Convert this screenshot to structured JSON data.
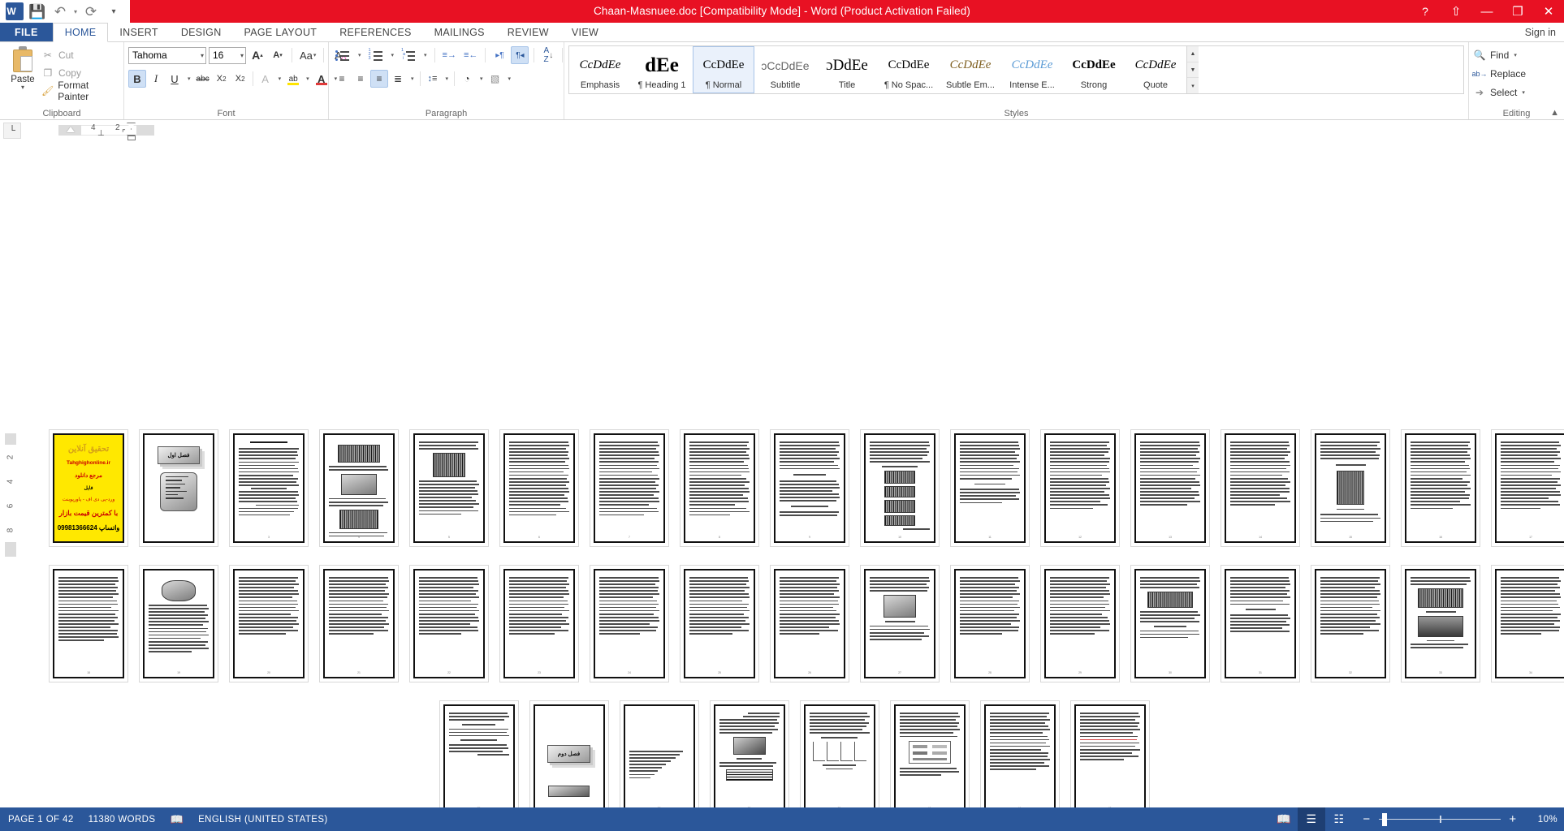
{
  "titlebar": {
    "title": "Chaan-Masnuee.doc [Compatibility Mode]  -  Word (Product Activation Failed)",
    "qat": [
      {
        "name": "word-logo-icon",
        "glyph": "W"
      },
      {
        "name": "save-icon",
        "glyph": "💾"
      },
      {
        "name": "undo-icon",
        "glyph": "↶"
      },
      {
        "name": "redo-icon",
        "glyph": "↻"
      },
      {
        "name": "customize-qat-icon",
        "glyph": "▾"
      }
    ],
    "window": [
      {
        "name": "help-icon",
        "glyph": "?"
      },
      {
        "name": "ribbon-display-options-icon",
        "glyph": "⬆"
      },
      {
        "name": "minimize-icon",
        "glyph": "—"
      },
      {
        "name": "restore-icon",
        "glyph": "❐"
      },
      {
        "name": "close-icon",
        "glyph": "✕"
      }
    ]
  },
  "tabs": {
    "file_label": "FILE",
    "items": [
      "HOME",
      "INSERT",
      "DESIGN",
      "PAGE LAYOUT",
      "REFERENCES",
      "MAILINGS",
      "REVIEW",
      "VIEW"
    ],
    "active": "HOME",
    "signin_label": "Sign in"
  },
  "ribbon": {
    "clipboard": {
      "group_label": "Clipboard",
      "paste_label": "Paste",
      "items": [
        {
          "label": "Cut",
          "icon": "scissors-icon",
          "glyph": "✂",
          "enabled": false
        },
        {
          "label": "Copy",
          "icon": "copy-icon",
          "glyph": "❐",
          "enabled": false
        },
        {
          "label": "Format Painter",
          "icon": "format-painter-icon",
          "glyph": "🖌",
          "enabled": true
        }
      ]
    },
    "font": {
      "group_label": "Font",
      "font_name": "Tahoma",
      "font_size": "16",
      "buttons": [
        {
          "name": "grow-font-button",
          "glyph": "A▴"
        },
        {
          "name": "shrink-font-button",
          "glyph": "A▾"
        },
        {
          "name": "change-case-button",
          "glyph": "Aa"
        },
        {
          "name": "clear-formatting-button",
          "glyph": "A"
        },
        {
          "name": "bold-button",
          "glyph": "B",
          "active": true
        },
        {
          "name": "italic-button",
          "glyph": "I"
        },
        {
          "name": "underline-button",
          "glyph": "U"
        },
        {
          "name": "strikethrough-button",
          "glyph": "abc"
        },
        {
          "name": "subscript-button",
          "glyph": "X₂"
        },
        {
          "name": "superscript-button",
          "glyph": "X²"
        },
        {
          "name": "text-effects-button",
          "glyph": "A"
        },
        {
          "name": "highlight-color-button",
          "glyph": "ab"
        },
        {
          "name": "font-color-button",
          "glyph": "A"
        }
      ]
    },
    "paragraph": {
      "group_label": "Paragraph",
      "buttons": [
        {
          "name": "bullets-button"
        },
        {
          "name": "numbering-button"
        },
        {
          "name": "multilevel-list-button"
        },
        {
          "name": "decrease-indent-button",
          "glyph": "≡→"
        },
        {
          "name": "increase-indent-button",
          "glyph": "≡←"
        },
        {
          "name": "ltr-text-direction-button",
          "glyph": "▸¶"
        },
        {
          "name": "rtl-text-direction-button",
          "glyph": "¶◂",
          "active": true
        },
        {
          "name": "sort-button",
          "glyph": "A↓"
        },
        {
          "name": "show-formatting-marks-button",
          "glyph": "¶"
        },
        {
          "name": "align-left-button",
          "glyph": "≡"
        },
        {
          "name": "align-center-button",
          "glyph": "≡"
        },
        {
          "name": "align-right-button",
          "glyph": "≡",
          "active": true
        },
        {
          "name": "justify-button",
          "glyph": "≡"
        },
        {
          "name": "line-spacing-button",
          "glyph": "↕≡"
        },
        {
          "name": "shading-button",
          "glyph": "▤"
        },
        {
          "name": "borders-button",
          "glyph": "⌷"
        }
      ]
    },
    "styles": {
      "group_label": "Styles",
      "selected": "Normal",
      "items": [
        {
          "name": "Emphasis",
          "preview": "CcDdEe",
          "style": "italic-serif"
        },
        {
          "name": "¶ Heading 1",
          "preview": "dEe",
          "style": "bold-big"
        },
        {
          "name": "¶ Normal",
          "preview": "CcDdEe",
          "style": "plain"
        },
        {
          "name": "Subtitle",
          "preview": "ɔCcDdEe",
          "style": "light"
        },
        {
          "name": "Title",
          "preview": "ɔDdEe",
          "style": "title"
        },
        {
          "name": "¶ No Spac...",
          "preview": "CcDdEe",
          "style": "plain"
        },
        {
          "name": "Subtle Em...",
          "preview": "CcDdEe",
          "style": "italic-serif"
        },
        {
          "name": "Intense E...",
          "preview": "CcDdEe",
          "style": "italic-blue"
        },
        {
          "name": "Strong",
          "preview": "CcDdEe",
          "style": "bold"
        },
        {
          "name": "Quote",
          "preview": "CcDdEe",
          "style": "italic-serif"
        }
      ]
    },
    "editing": {
      "group_label": "Editing",
      "items": [
        {
          "label": "Find",
          "icon": "binoculars-icon",
          "glyph": "🔍",
          "has_caret": true
        },
        {
          "label": "Replace",
          "icon": "replace-icon",
          "glyph": "ab",
          "has_caret": false
        },
        {
          "label": "Select",
          "icon": "pointer-icon",
          "glyph": "➤",
          "has_caret": true
        }
      ]
    },
    "collapse_icon": "chevron-up-icon"
  },
  "ruler": {
    "tab_stop_glyph": "└",
    "h_numbers": [
      "4",
      "2"
    ],
    "v_numbers": [
      "2",
      "4",
      "6",
      "8"
    ]
  },
  "document": {
    "rows": [
      {
        "pages": [
          {
            "n": 1,
            "kind": "ad"
          },
          {
            "n": 2,
            "kind": "chapter",
            "chapter_label": "فصل اول"
          },
          {
            "n": 3,
            "kind": "text",
            "heading": true
          },
          {
            "n": 4,
            "kind": "text-images",
            "images": 3
          },
          {
            "n": 5,
            "kind": "text-images",
            "images": 2
          },
          {
            "n": 6,
            "kind": "text"
          },
          {
            "n": 7,
            "kind": "text"
          },
          {
            "n": 8,
            "kind": "text"
          },
          {
            "n": 9,
            "kind": "text"
          },
          {
            "n": 10,
            "kind": "text-dark"
          },
          {
            "n": 11,
            "kind": "text"
          },
          {
            "n": 12,
            "kind": "text"
          },
          {
            "n": 13,
            "kind": "text"
          },
          {
            "n": 14,
            "kind": "text"
          },
          {
            "n": 15,
            "kind": "text-dark-small"
          },
          {
            "n": 16,
            "kind": "text"
          },
          {
            "n": 17,
            "kind": "text"
          }
        ]
      },
      {
        "pages": [
          {
            "n": 18,
            "kind": "text"
          },
          {
            "n": 19,
            "kind": "text-soft"
          },
          {
            "n": 20,
            "kind": "text"
          },
          {
            "n": 21,
            "kind": "text"
          },
          {
            "n": 22,
            "kind": "text"
          },
          {
            "n": 23,
            "kind": "text"
          },
          {
            "n": 24,
            "kind": "text"
          },
          {
            "n": 25,
            "kind": "text"
          },
          {
            "n": 26,
            "kind": "text"
          },
          {
            "n": 27,
            "kind": "text-photo"
          },
          {
            "n": 28,
            "kind": "text"
          },
          {
            "n": 29,
            "kind": "text"
          },
          {
            "n": 30,
            "kind": "text-photo"
          },
          {
            "n": 31,
            "kind": "text"
          },
          {
            "n": 32,
            "kind": "text"
          },
          {
            "n": 33,
            "kind": "text-photo2"
          },
          {
            "n": 34,
            "kind": "text"
          }
        ]
      },
      {
        "pages": [
          {
            "n": 35,
            "kind": "text"
          },
          {
            "n": 36,
            "kind": "chapter",
            "chapter_label": "فصل دوم"
          },
          {
            "n": 37,
            "kind": "text-sparse"
          },
          {
            "n": 38,
            "kind": "text-diagram"
          },
          {
            "n": 39,
            "kind": "text-chart"
          },
          {
            "n": 40,
            "kind": "text"
          },
          {
            "n": 41,
            "kind": "text"
          },
          {
            "n": 42,
            "kind": "text-red"
          }
        ]
      }
    ]
  },
  "statusbar": {
    "page_label": "PAGE 1 OF 42",
    "words_label": "11380 WORDS",
    "proofing_icon": "proofing-errors-icon",
    "language_label": "ENGLISH (UNITED STATES)",
    "views": [
      {
        "name": "read-mode-button",
        "glyph": "📖",
        "active": false
      },
      {
        "name": "print-layout-button",
        "glyph": "☰",
        "active": true
      },
      {
        "name": "web-layout-button",
        "glyph": "☷",
        "active": false
      }
    ],
    "zoom_out_glyph": "−",
    "zoom_in_glyph": "+",
    "zoom_level": "10%"
  },
  "colors": {
    "title_red": "#e81123",
    "word_blue": "#2b579a",
    "accent_blue": "#cfe0f5",
    "ad_yellow": "#ffe800"
  }
}
